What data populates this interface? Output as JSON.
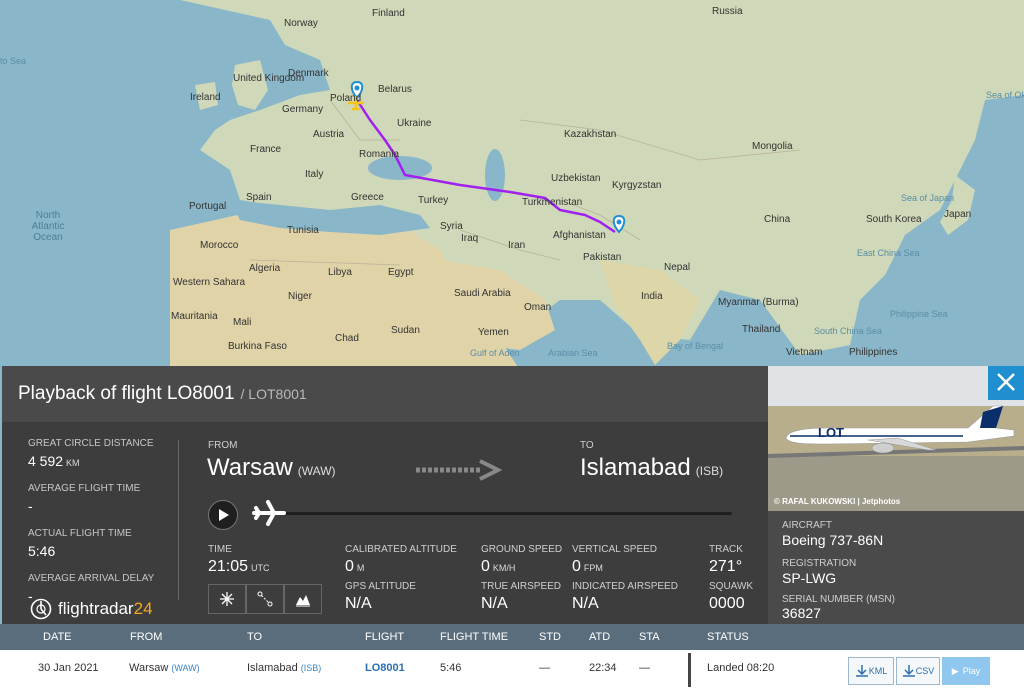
{
  "map": {
    "countries": [
      "Norway",
      "Finland",
      "Russia",
      "Denmark",
      "United Kingdom",
      "Ireland",
      "Germany",
      "Poland",
      "Belarus",
      "Ukraine",
      "Austria",
      "France",
      "Romania",
      "Italy",
      "Portugal",
      "Spain",
      "Greece",
      "Turkey",
      "Kazakhstan",
      "Mongolia",
      "Uzbekistan",
      "Kyrgyzstan",
      "Turkmenistan",
      "Afghanistan",
      "Pakistan",
      "India",
      "China",
      "Syria",
      "Iraq",
      "Iran",
      "Tunisia",
      "Morocco",
      "Algeria",
      "Libya",
      "Egypt",
      "Saudi Arabia",
      "Oman",
      "Yemen",
      "Western Sahara",
      "Mauritania",
      "Mali",
      "Niger",
      "Chad",
      "Sudan",
      "Burkina Faso",
      "Nepal",
      "Myanmar (Burma)",
      "Thailand",
      "Vietnam",
      "Philippines",
      "South Korea",
      "Japan"
    ],
    "seas": [
      "North Atlantic Ocean",
      "Sea of Japan",
      "East China Sea",
      "South China Sea",
      "Philippine Sea",
      "Bay of Bengal",
      "Arabian Sea",
      "Gulf of Aden",
      "Sea of Okhotsk",
      "to Sea"
    ],
    "route_color": "#a020f0",
    "origin_pin": "pin-icon",
    "destination_pin": "pin-icon"
  },
  "panel": {
    "title": "Playback of flight LO8001",
    "subtitle": "/ LOT8001",
    "stats": {
      "great_circle_label": "GREAT CIRCLE DISTANCE",
      "great_circle_value": "4 592",
      "great_circle_unit": "KM",
      "avg_flight_label": "AVERAGE FLIGHT TIME",
      "avg_flight_value": "-",
      "actual_flight_label": "ACTUAL FLIGHT TIME",
      "actual_flight_value": "5:46",
      "avg_delay_label": "AVERAGE ARRIVAL DELAY",
      "avg_delay_value": "-"
    },
    "from_label": "FROM",
    "from_city": "Warsaw",
    "from_code": "(WAW)",
    "to_label": "TO",
    "to_city": "Islamabad",
    "to_code": "(ISB)",
    "time_label": "TIME",
    "time_value": "21:05",
    "time_unit": "UTC",
    "cal_alt_label": "CALIBRATED ALTITUDE",
    "cal_alt_value": "0",
    "cal_alt_unit": "M",
    "gps_alt_label": "GPS ALTITUDE",
    "gps_alt_value": "N/A",
    "ground_speed_label": "GROUND SPEED",
    "ground_speed_value": "0",
    "ground_speed_unit": "KM/H",
    "true_airspeed_label": "TRUE AIRSPEED",
    "true_airspeed_value": "N/A",
    "vertical_speed_label": "VERTICAL SPEED",
    "vertical_speed_value": "0",
    "vertical_speed_unit": "FPM",
    "indicated_airspeed_label": "INDICATED AIRSPEED",
    "indicated_airspeed_value": "N/A",
    "track_label": "TRACK",
    "track_value": "271°",
    "squawk_label": "SQUAWK",
    "squawk_value": "0000",
    "logo_text": "flightradar",
    "logo_number": "24",
    "playback_progress": 0
  },
  "aircraft": {
    "credit": "© RAFAL KUKOWSKI | Jetphotos",
    "livery_text": "LOT",
    "aircraft_label": "AIRCRAFT",
    "aircraft_value": "Boeing 737-86N",
    "registration_label": "REGISTRATION",
    "registration_value": "SP-LWG",
    "serial_label": "SERIAL NUMBER (MSN)",
    "serial_value": "36827"
  },
  "table": {
    "headers": [
      "DATE",
      "FROM",
      "TO",
      "FLIGHT",
      "FLIGHT TIME",
      "STD",
      "ATD",
      "STA",
      "STATUS"
    ],
    "row": {
      "date": "30 Jan 2021",
      "from_city": "Warsaw",
      "from_code": "(WAW)",
      "to_city": "Islamabad",
      "to_code": "(ISB)",
      "flight": "LO8001",
      "flight_time": "5:46",
      "std": "—",
      "atd": "22:34",
      "sta": "—",
      "status": "Landed 08:20",
      "kml_label": "KML",
      "csv_label": "CSV",
      "play_label": "Play"
    }
  },
  "colors": {
    "panel_bg": "#3d3d3d",
    "header_bg": "#4a4a4a",
    "close_bg": "#1f8fd0",
    "table_header": "#5a6d7c",
    "logo_accent": "#f5a623"
  }
}
